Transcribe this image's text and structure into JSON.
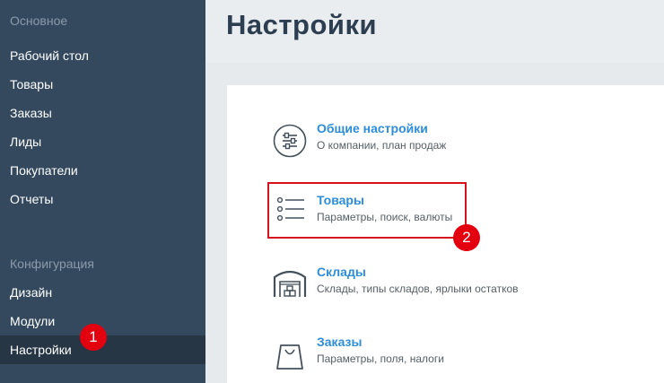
{
  "sidebar": {
    "section_main": "Основное",
    "main_items": [
      {
        "label": "Рабочий стол"
      },
      {
        "label": "Товары"
      },
      {
        "label": "Заказы"
      },
      {
        "label": "Лиды"
      },
      {
        "label": "Покупатели"
      },
      {
        "label": "Отчеты"
      }
    ],
    "section_config": "Конфигурация",
    "config_items": [
      {
        "label": "Дизайн"
      },
      {
        "label": "Модули"
      },
      {
        "label": "Настройки"
      }
    ],
    "active_item": "Настройки"
  },
  "page": {
    "title": "Настройки"
  },
  "settings": [
    {
      "title": "Общие настройки",
      "description": "О компании, план продаж",
      "icon": "sliders-icon"
    },
    {
      "title": "Товары",
      "description": "Параметры, поиск, валюты",
      "icon": "list-icon"
    },
    {
      "title": "Склады",
      "description": "Склады, типы складов, ярлыки остатков",
      "icon": "warehouse-icon"
    },
    {
      "title": "Заказы",
      "description": "Параметры, поля, налоги",
      "icon": "shopping-bag-icon"
    }
  ],
  "annotations": {
    "step1": "1",
    "step2": "2"
  },
  "colors": {
    "sidebar_bg": "#34495e",
    "sidebar_active_bg": "#263644",
    "link_blue": "#2d8ed7",
    "annotation_red": "#e3000f"
  }
}
